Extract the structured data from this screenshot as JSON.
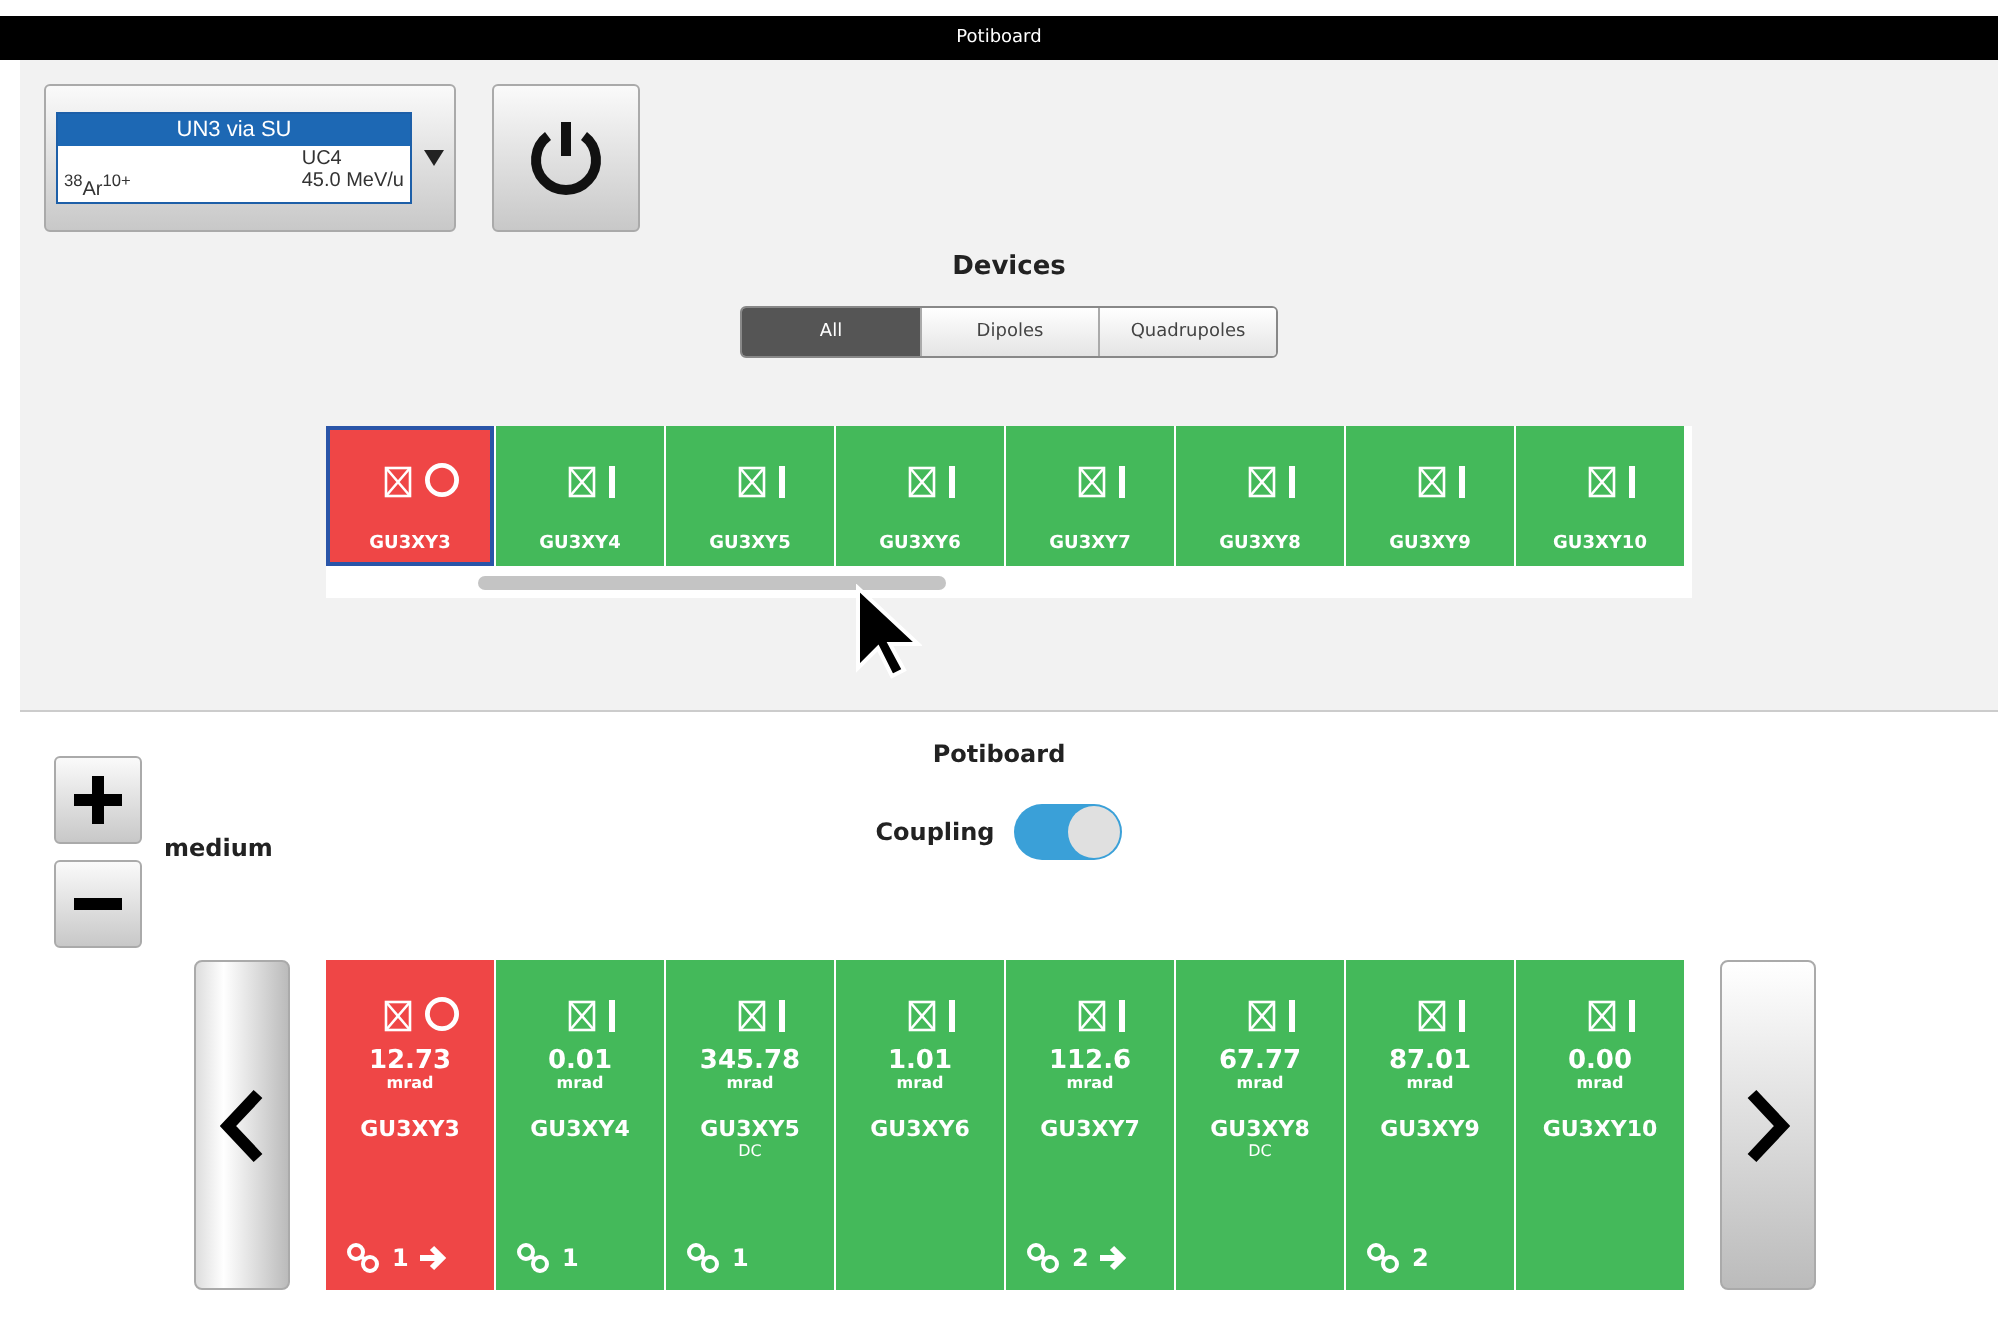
{
  "window": {
    "title": "Potiboard"
  },
  "beam": {
    "line": "UN3 via SU",
    "ion": "$^{38}$Ar$^{10+}$",
    "source": "UC4",
    "energy": "45.0 MeV/u"
  },
  "devices": {
    "title": "Devices",
    "filters": [
      {
        "label": "All",
        "selected": true
      },
      {
        "label": "Dipoles",
        "selected": false
      },
      {
        "label": "Quadrupoles",
        "selected": false
      }
    ],
    "items": [
      {
        "name": "GU3XY3",
        "on": false,
        "selected": true
      },
      {
        "name": "GU3XY4",
        "on": true,
        "selected": false
      },
      {
        "name": "GU3XY5",
        "on": true,
        "selected": false
      },
      {
        "name": "GU3XY6",
        "on": true,
        "selected": false
      },
      {
        "name": "GU3XY7",
        "on": true,
        "selected": false
      },
      {
        "name": "GU3XY8",
        "on": true,
        "selected": false
      },
      {
        "name": "GU3XY9",
        "on": true,
        "selected": false
      },
      {
        "name": "GU3XY10",
        "on": true,
        "selected": false
      }
    ]
  },
  "potiboard": {
    "title": "Potiboard",
    "step": "medium",
    "coupling": {
      "label": "Coupling",
      "on": true
    },
    "items": [
      {
        "value": "12.73",
        "unit": "mrad",
        "name": "GU3XY3",
        "on": false,
        "link": "1",
        "arrow": true
      },
      {
        "value": "0.01",
        "unit": "mrad",
        "name": "GU3XY4",
        "on": true,
        "link": "1",
        "arrow": false
      },
      {
        "value": "345.78",
        "unit": "mrad",
        "name": "GU3XY5",
        "note": "DC",
        "on": true,
        "link": "1",
        "arrow": false
      },
      {
        "value": "1.01",
        "unit": "mrad",
        "name": "GU3XY6",
        "on": true,
        "arrow": false
      },
      {
        "value": "112.6",
        "unit": "mrad",
        "name": "GU3XY7",
        "on": true,
        "link": "2",
        "arrow": true
      },
      {
        "value": "67.77",
        "unit": "mrad",
        "name": "GU3XY8",
        "note": "DC",
        "on": true,
        "arrow": false
      },
      {
        "value": "87.01",
        "unit": "mrad",
        "name": "GU3XY9",
        "on": true,
        "link": "2",
        "arrow": false
      },
      {
        "value": "0.00",
        "unit": "mrad",
        "name": "GU3XY10",
        "on": true,
        "arrow": false
      }
    ]
  }
}
